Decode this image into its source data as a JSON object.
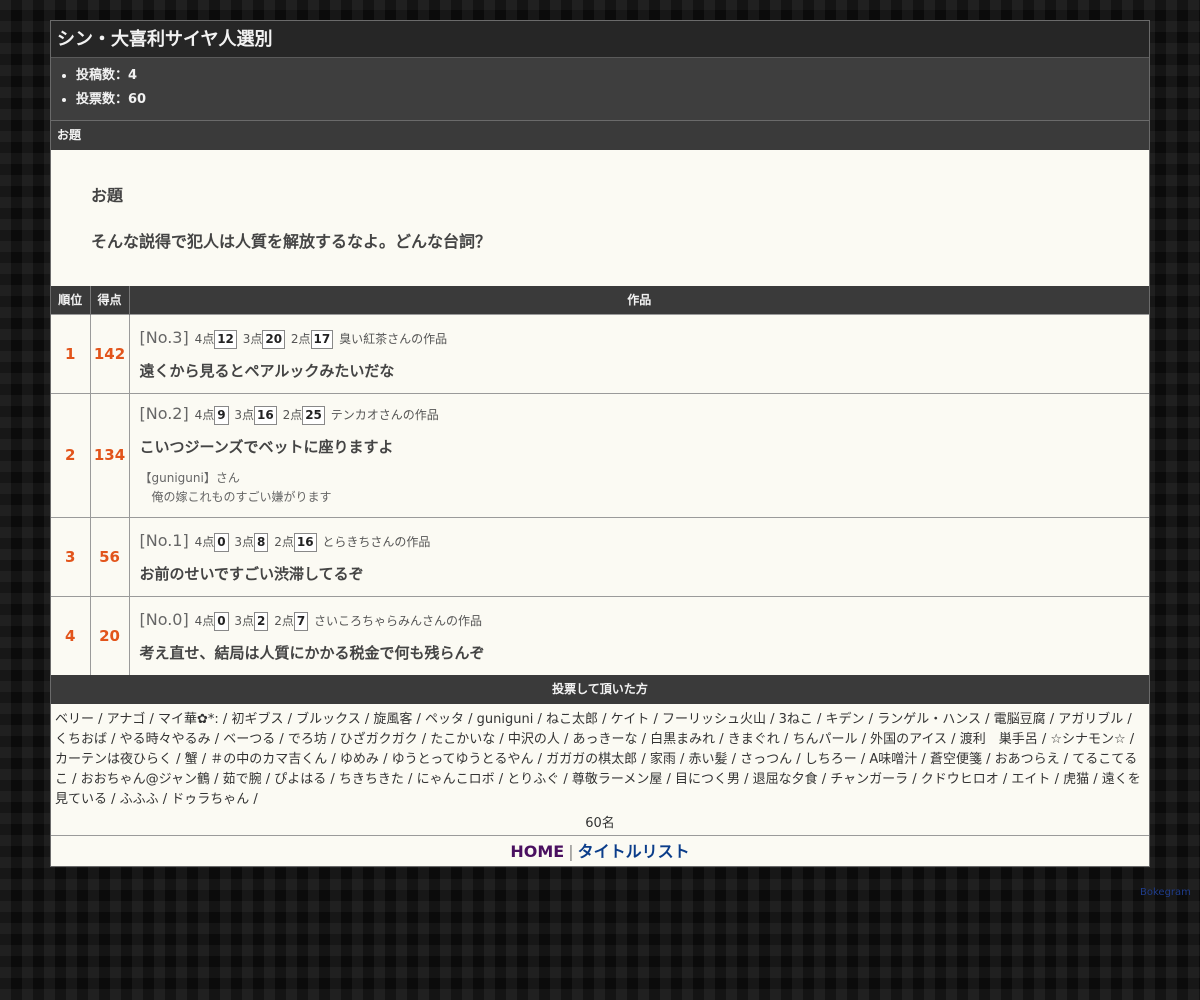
{
  "title": "シン・大喜利サイヤ人選別 ",
  "stats": [
    {
      "label": "投稿数：4"
    },
    {
      "label": "投票数：60"
    }
  ],
  "odai_header": "お題",
  "odai_label": "お題",
  "odai_text": "そんな説得で犯人は人質を解放するなよ。どんな台詞？",
  "columns": {
    "rank": "順位",
    "score": "得点",
    "work": "作品"
  },
  "entries": [
    {
      "rank": "1",
      "score": "142",
      "no": "[No.3]",
      "p4_label": "4点",
      "p4": "12",
      "p3_label": "3点",
      "p3": "20",
      "p2_label": "2点",
      "p2": "17",
      "author": "臭い紅茶さんの作品",
      "text": "遠くから見るとペアルックみたいだな"
    },
    {
      "rank": "2",
      "score": "134",
      "no": "[No.2]",
      "p4_label": "4点",
      "p4": "9",
      "p3_label": "3点",
      "p3": "16",
      "p2_label": "2点",
      "p2": "25",
      "author": "テンカオさんの作品",
      "text": "こいつジーンズでベットに座りますよ",
      "comment_author": "【guniguni】さん",
      "comment_text": "俺の嫁これものすごい嫌がります"
    },
    {
      "rank": "3",
      "score": "56",
      "no": "[No.1]",
      "p4_label": "4点",
      "p4": "0",
      "p3_label": "3点",
      "p3": "8",
      "p2_label": "2点",
      "p2": "16",
      "author": "とらきちさんの作品",
      "text": "お前のせいですごい渋滞してるぞ"
    },
    {
      "rank": "4",
      "score": "20",
      "no": "[No.0]",
      "p4_label": "4点",
      "p4": "0",
      "p3_label": "3点",
      "p3": "2",
      "p2_label": "2点",
      "p2": "7",
      "author": "さいころちゃらみんさんの作品",
      "text": "考え直せ、結局は人質にかかる税金で何も残らんぞ"
    }
  ],
  "voters_header": "投票して頂いた方",
  "voters_text": "ベリー / アナゴ / マイ華✿*: / 初ギブス / ブルックス / 旋風客 / ペッタ / guniguni / ねこ太郎 / ケイト / フーリッシュ火山 / 3ねこ / キデン / ランゲル・ハンス / 電脳豆腐 / アガリブル / くちおば / やる時々やるみ / ベーつる / でろ坊 / ひざガクガク / たこかいな / 中沢の人 / あっきーな / 白黒まみれ / きまぐれ / ちんパール / 外国のアイス / 渡利　巣手呂 / ☆シナモン☆ / カーテンは夜ひらく / 蟹 / ＃の中のカマ吉くん / ゆめみ / ゆうとってゆうとるやん / ガガガの棋太郎 / 家雨 / 赤い髪 / さっつん / しちろー / A味噌汁 / 蒼空便箋 / おあつらえ / てるこてるこ / おおちゃん@ジャン鶴 / 茹で腕 / ぴよはる / ちきちきた / にゃんこロボ / とりふぐ / 尊敬ラーメン屋 / 目につく男 / 退屈な夕食 / チャンガーラ / クドウヒロオ / エイト / 虎猫 / 遠くを見ている / ふふふ / ドゥラちゃん /",
  "voter_count": "60名",
  "nav": {
    "home": "HOME",
    "separator": "|",
    "title_list": "タイトルリスト"
  },
  "credit": "Bokegram"
}
